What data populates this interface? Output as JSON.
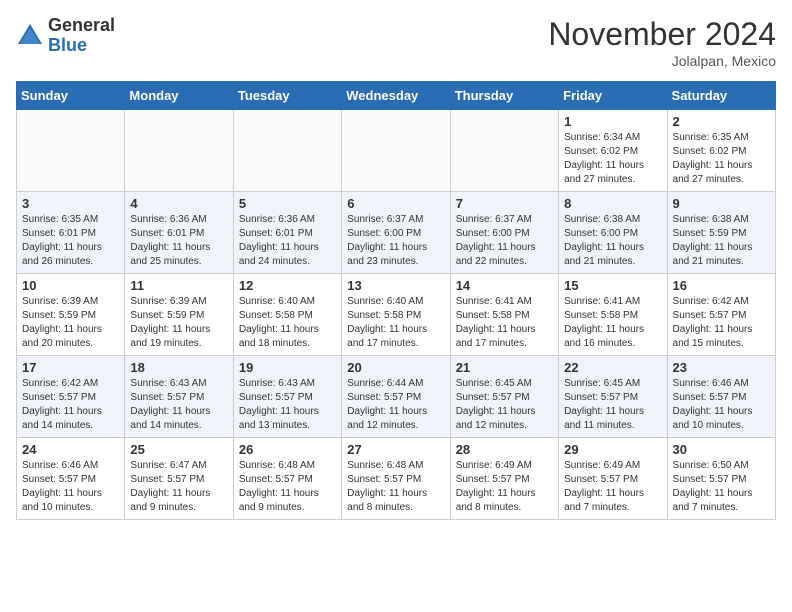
{
  "logo": {
    "general": "General",
    "blue": "Blue"
  },
  "title": "November 2024",
  "location": "Jolalpan, Mexico",
  "days_header": [
    "Sunday",
    "Monday",
    "Tuesday",
    "Wednesday",
    "Thursday",
    "Friday",
    "Saturday"
  ],
  "weeks": [
    [
      {
        "day": "",
        "info": ""
      },
      {
        "day": "",
        "info": ""
      },
      {
        "day": "",
        "info": ""
      },
      {
        "day": "",
        "info": ""
      },
      {
        "day": "",
        "info": ""
      },
      {
        "day": "1",
        "info": "Sunrise: 6:34 AM\nSunset: 6:02 PM\nDaylight: 11 hours and 27 minutes."
      },
      {
        "day": "2",
        "info": "Sunrise: 6:35 AM\nSunset: 6:02 PM\nDaylight: 11 hours and 27 minutes."
      }
    ],
    [
      {
        "day": "3",
        "info": "Sunrise: 6:35 AM\nSunset: 6:01 PM\nDaylight: 11 hours and 26 minutes."
      },
      {
        "day": "4",
        "info": "Sunrise: 6:36 AM\nSunset: 6:01 PM\nDaylight: 11 hours and 25 minutes."
      },
      {
        "day": "5",
        "info": "Sunrise: 6:36 AM\nSunset: 6:01 PM\nDaylight: 11 hours and 24 minutes."
      },
      {
        "day": "6",
        "info": "Sunrise: 6:37 AM\nSunset: 6:00 PM\nDaylight: 11 hours and 23 minutes."
      },
      {
        "day": "7",
        "info": "Sunrise: 6:37 AM\nSunset: 6:00 PM\nDaylight: 11 hours and 22 minutes."
      },
      {
        "day": "8",
        "info": "Sunrise: 6:38 AM\nSunset: 6:00 PM\nDaylight: 11 hours and 21 minutes."
      },
      {
        "day": "9",
        "info": "Sunrise: 6:38 AM\nSunset: 5:59 PM\nDaylight: 11 hours and 21 minutes."
      }
    ],
    [
      {
        "day": "10",
        "info": "Sunrise: 6:39 AM\nSunset: 5:59 PM\nDaylight: 11 hours and 20 minutes."
      },
      {
        "day": "11",
        "info": "Sunrise: 6:39 AM\nSunset: 5:59 PM\nDaylight: 11 hours and 19 minutes."
      },
      {
        "day": "12",
        "info": "Sunrise: 6:40 AM\nSunset: 5:58 PM\nDaylight: 11 hours and 18 minutes."
      },
      {
        "day": "13",
        "info": "Sunrise: 6:40 AM\nSunset: 5:58 PM\nDaylight: 11 hours and 17 minutes."
      },
      {
        "day": "14",
        "info": "Sunrise: 6:41 AM\nSunset: 5:58 PM\nDaylight: 11 hours and 17 minutes."
      },
      {
        "day": "15",
        "info": "Sunrise: 6:41 AM\nSunset: 5:58 PM\nDaylight: 11 hours and 16 minutes."
      },
      {
        "day": "16",
        "info": "Sunrise: 6:42 AM\nSunset: 5:57 PM\nDaylight: 11 hours and 15 minutes."
      }
    ],
    [
      {
        "day": "17",
        "info": "Sunrise: 6:42 AM\nSunset: 5:57 PM\nDaylight: 11 hours and 14 minutes."
      },
      {
        "day": "18",
        "info": "Sunrise: 6:43 AM\nSunset: 5:57 PM\nDaylight: 11 hours and 14 minutes."
      },
      {
        "day": "19",
        "info": "Sunrise: 6:43 AM\nSunset: 5:57 PM\nDaylight: 11 hours and 13 minutes."
      },
      {
        "day": "20",
        "info": "Sunrise: 6:44 AM\nSunset: 5:57 PM\nDaylight: 11 hours and 12 minutes."
      },
      {
        "day": "21",
        "info": "Sunrise: 6:45 AM\nSunset: 5:57 PM\nDaylight: 11 hours and 12 minutes."
      },
      {
        "day": "22",
        "info": "Sunrise: 6:45 AM\nSunset: 5:57 PM\nDaylight: 11 hours and 11 minutes."
      },
      {
        "day": "23",
        "info": "Sunrise: 6:46 AM\nSunset: 5:57 PM\nDaylight: 11 hours and 10 minutes."
      }
    ],
    [
      {
        "day": "24",
        "info": "Sunrise: 6:46 AM\nSunset: 5:57 PM\nDaylight: 11 hours and 10 minutes."
      },
      {
        "day": "25",
        "info": "Sunrise: 6:47 AM\nSunset: 5:57 PM\nDaylight: 11 hours and 9 minutes."
      },
      {
        "day": "26",
        "info": "Sunrise: 6:48 AM\nSunset: 5:57 PM\nDaylight: 11 hours and 9 minutes."
      },
      {
        "day": "27",
        "info": "Sunrise: 6:48 AM\nSunset: 5:57 PM\nDaylight: 11 hours and 8 minutes."
      },
      {
        "day": "28",
        "info": "Sunrise: 6:49 AM\nSunset: 5:57 PM\nDaylight: 11 hours and 8 minutes."
      },
      {
        "day": "29",
        "info": "Sunrise: 6:49 AM\nSunset: 5:57 PM\nDaylight: 11 hours and 7 minutes."
      },
      {
        "day": "30",
        "info": "Sunrise: 6:50 AM\nSunset: 5:57 PM\nDaylight: 11 hours and 7 minutes."
      }
    ]
  ]
}
